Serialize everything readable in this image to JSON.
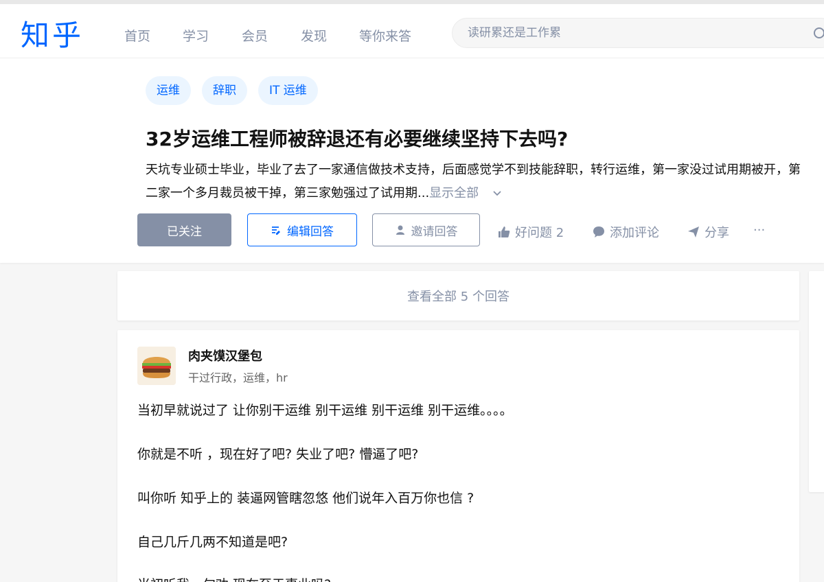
{
  "nav": {
    "logo": "知乎",
    "links": [
      "首页",
      "学习",
      "会员",
      "发现",
      "等你来答"
    ],
    "search_placeholder": "读研累还是工作累"
  },
  "question": {
    "tags": [
      "运维",
      "辞职",
      "IT 运维"
    ],
    "title": "32岁运维工程师被辞退还有必要继续坚持下去吗?",
    "description": "天坑专业硕士毕业，毕业了去了一家通信做技术支持，后面感觉学不到技能辞职，转行运维，第一家没过试用期被开，第二家一个多月裁员被干掉，第三家勉强过了试用期...",
    "show_all": "显示全部",
    "actions": {
      "followed": "已关注",
      "edit_answer": "编辑回答",
      "invite": "邀请回答",
      "good_question": "好问题 2",
      "add_comment": "添加评论",
      "share": "分享",
      "more": "···"
    }
  },
  "view_all_answers": "查看全部 5 个回答",
  "answer": {
    "author_name": "肉夹馍汉堡包",
    "author_headline": "干过行政，运维，hr",
    "paragraphs": [
      "当初早就说过了 让你别干运维 别干运维 别干运维 别干运维。。。。",
      "你就是不听 ，现在好了吧? 失业了吧? 懵逼了吧?",
      "叫你听 知乎上的 装逼网管瞎忽悠 他们说年入百万你也信 ?",
      "自己几斤几两不知道是吧?",
      "当初听我一句劝 现在至于事业吗?"
    ]
  },
  "colors": {
    "brand": "#0066ff",
    "muted": "#8590a6",
    "tag_bg": "#ebf5ff"
  }
}
